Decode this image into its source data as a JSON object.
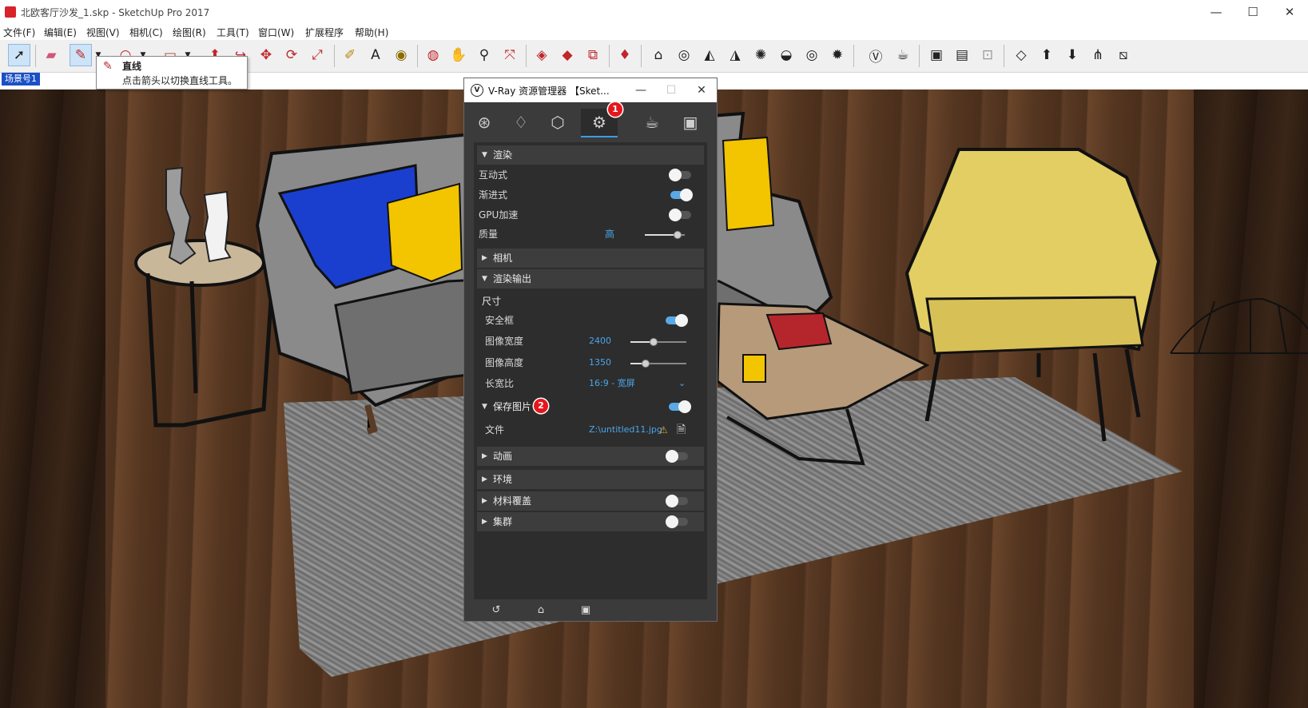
{
  "window": {
    "title": "北欧客厅沙发_1.skp - SketchUp Pro 2017",
    "minimize": "—",
    "maximize": "☐",
    "close": "✕"
  },
  "menu": [
    "文件(F)",
    "编辑(E)",
    "视图(V)",
    "相机(C)",
    "绘图(R)",
    "工具(T)",
    "窗口(W)",
    "扩展程序",
    "帮助(H)"
  ],
  "scene_tab": "场景号1",
  "tooltip": {
    "title": "直线",
    "description": "点击箭头以切换直线工具。"
  },
  "toolbar_icons": [
    "select-icon",
    "eraser-icon",
    "pencil-icon",
    "arc-icon",
    "rectangle-icon",
    "push-pull-icon",
    "follow-me-icon",
    "move-icon",
    "rotate-icon",
    "scale-icon",
    "tape-measure-icon",
    "text-icon",
    "paint-bucket-icon",
    "orbit-icon",
    "pan-icon",
    "zoom-icon",
    "zoom-extents-icon",
    "3d-warehouse-icon",
    "extension-warehouse-icon",
    "send-to-layout-icon",
    "ruby-console-icon"
  ],
  "vray": {
    "title": "V-Ray 资源管理器 【Sket...",
    "badge1": "1",
    "badge2": "2",
    "sections": {
      "render": "渲染",
      "camera": "相机",
      "render_output": "渲染输出",
      "save_image": "保存图片",
      "animation": "动画",
      "environment": "环境",
      "material_override": "材料覆盖",
      "swarm": "集群"
    },
    "render": {
      "interactive": {
        "label": "互动式",
        "on": false
      },
      "progressive": {
        "label": "渐进式",
        "on": true
      },
      "gpu": {
        "label": "GPU加速",
        "on": false
      },
      "quality": {
        "label": "质量",
        "value": "高"
      }
    },
    "output": {
      "size_label": "尺寸",
      "safe_frame": {
        "label": "安全框",
        "on": true
      },
      "width": {
        "label": "图像宽度",
        "value": "2400"
      },
      "height": {
        "label": "图像高度",
        "value": "1350"
      },
      "aspect": {
        "label": "长宽比",
        "value": "16:9 - 宽屏"
      }
    },
    "save_image_on": true,
    "file": {
      "label": "文件",
      "value": "Z:\\untitled11.jpg"
    },
    "animation_on": false,
    "material_override_on": false,
    "swarm_on": false,
    "accent_color": "#3d9be0",
    "badge_color": "#e5171d"
  }
}
